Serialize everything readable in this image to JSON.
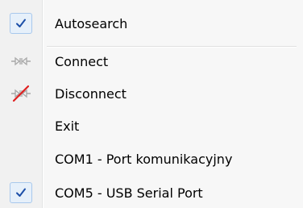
{
  "menu": {
    "items": [
      {
        "label": "Autosearch",
        "checked": true,
        "icon": "check-icon"
      },
      {
        "label": "Connect",
        "icon": "connect-plug-icon"
      },
      {
        "label": "Disconnect",
        "icon": "disconnect-plug-icon"
      },
      {
        "label": "Exit"
      },
      {
        "label": "COM1 - Port komunikacyjny"
      },
      {
        "label": "COM5 - USB Serial Port",
        "checked": true,
        "icon": "check-icon"
      }
    ]
  },
  "colors": {
    "check": "#1c4fa8",
    "plug": "#a8a8a8",
    "strike": "#e02020"
  }
}
